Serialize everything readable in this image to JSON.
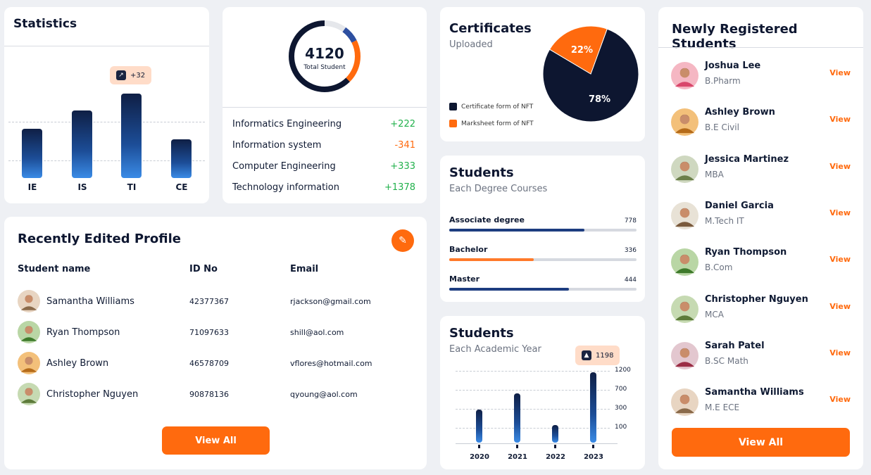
{
  "statistics": {
    "title": "Statistics",
    "badge": "+32",
    "bars": [
      {
        "label": "IE",
        "value": 0.58
      },
      {
        "label": "IS",
        "value": 0.8
      },
      {
        "label": "TI",
        "value": 1.0
      },
      {
        "label": "CE",
        "value": 0.46
      }
    ]
  },
  "total": {
    "value": "4120",
    "label": "Total Student",
    "departments": [
      {
        "name": "Informatics Engineering",
        "change": "+222",
        "status": "pos"
      },
      {
        "name": "Information system",
        "change": "-341",
        "status": "neg"
      },
      {
        "name": "Computer Engineering",
        "change": "+333",
        "status": "pos"
      },
      {
        "name": "Technology information",
        "change": "+1378",
        "status": "pos"
      }
    ]
  },
  "certificates": {
    "title": "Certificates",
    "subtitle": "Uploaded",
    "slices": [
      {
        "label": "78%",
        "value": 78,
        "color": "#0d1630"
      },
      {
        "label": "22%",
        "value": 22,
        "color": "#ff6a0e"
      }
    ],
    "legend": [
      "Certificate form of NFT",
      "Marksheet form of NFT"
    ]
  },
  "degree": {
    "title": "Students",
    "subtitle": "Each Degree Courses",
    "rows": [
      {
        "name": "Associate degree",
        "value": "778",
        "fill": 0.72,
        "color": "#1d3d80"
      },
      {
        "name": "Bachelor",
        "value": "336",
        "fill": 0.45,
        "color": "#ff7a2a"
      },
      {
        "name": "Master",
        "value": "444",
        "fill": 0.64,
        "color": "#1d3d80"
      }
    ]
  },
  "yearchart": {
    "title": "Students",
    "subtitle": "Each Academic Year",
    "badge": "1198",
    "ticks": [
      "1200",
      "700",
      "300",
      "100"
    ],
    "years": [
      {
        "year": "2020",
        "value": 0.47
      },
      {
        "year": "2021",
        "value": 0.7
      },
      {
        "year": "2022",
        "value": 0.25
      },
      {
        "year": "2023",
        "value": 1.0
      }
    ]
  },
  "recent": {
    "title": "Recently Edited Profile",
    "headers": {
      "name": "Student name",
      "id": "ID No",
      "email": "Email"
    },
    "rows": [
      {
        "name": "Samantha Williams",
        "id": "42377367",
        "email": "rjackson@gmail.com"
      },
      {
        "name": "Ryan Thompson",
        "id": "71097633",
        "email": "shill@aol.com"
      },
      {
        "name": "Ashley Brown",
        "id": "46578709",
        "email": "vflores@hotmail.com"
      },
      {
        "name": "Christopher Nguyen",
        "id": "90878136",
        "email": "qyoung@aol.com"
      }
    ],
    "button": "View All"
  },
  "newreg": {
    "title": "Newly Registered Students",
    "view": "View",
    "button": "View All",
    "students": [
      {
        "name": "Joshua Lee",
        "course": "B.Pharm"
      },
      {
        "name": "Ashley Brown",
        "course": "B.E Civil"
      },
      {
        "name": "Jessica Martinez",
        "course": "MBA"
      },
      {
        "name": "Daniel Garcia",
        "course": "M.Tech IT"
      },
      {
        "name": "Ryan Thompson",
        "course": "B.Com"
      },
      {
        "name": "Christopher Nguyen",
        "course": "MCA"
      },
      {
        "name": "Sarah Patel",
        "course": "B.SC Math"
      },
      {
        "name": "Samantha Williams",
        "course": "M.E ECE"
      }
    ]
  }
}
